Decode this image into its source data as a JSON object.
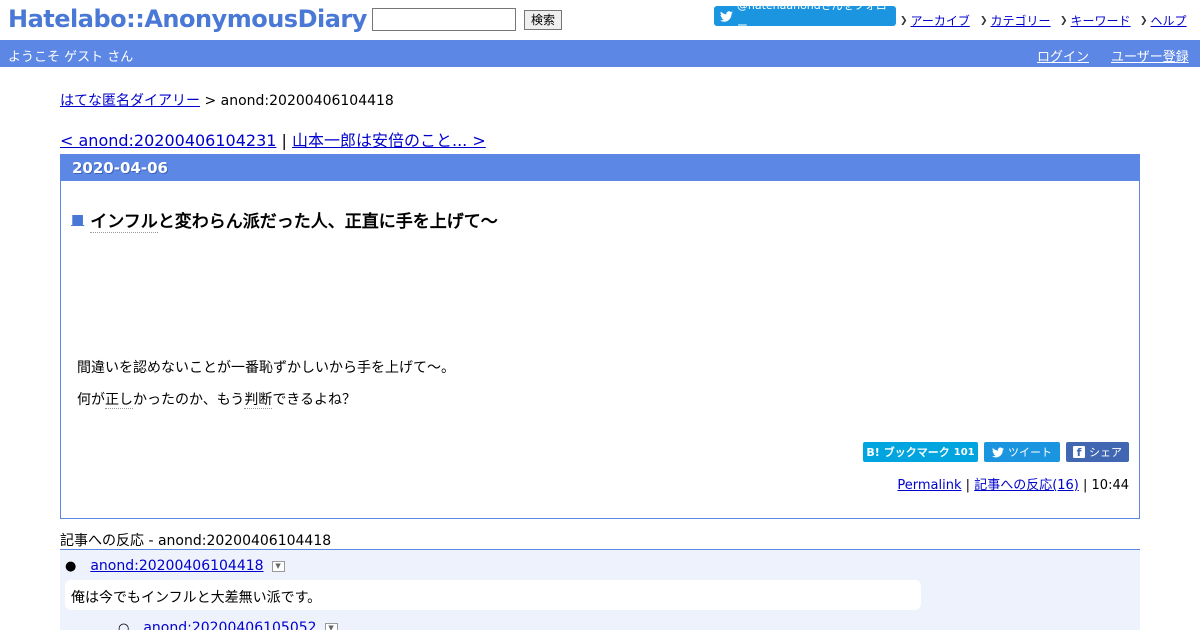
{
  "header": {
    "logo": "Hatelabo::AnonymousDiary",
    "search_button": "検索",
    "follow_button": "@hatenaanondさんをフォロー",
    "nav": [
      {
        "label": "アーカイブ"
      },
      {
        "label": "カテゴリー"
      },
      {
        "label": "キーワード"
      },
      {
        "label": "ヘルプ"
      }
    ]
  },
  "bluebar": {
    "welcome": "ようこそ ゲスト さん",
    "login": "ログイン",
    "register": "ユーザー登録"
  },
  "breadcrumb": {
    "home": "はてな匿名ダイアリー",
    "separator": " > ",
    "current": "anond:20200406104418"
  },
  "prevnext": {
    "prev": "< anond:20200406104231",
    "separator": " | ",
    "next": "山本一郎は安倍のこと... >"
  },
  "day": {
    "date": "2020-04-06",
    "entry": {
      "marker": "■",
      "title_kw": "インフル",
      "title_rest": "と変わらん派だった人、正直に手を上げて～",
      "para1": "間違いを認めないことが一番恥ずかしいから手を上げて～。",
      "para2_a": "何が",
      "para2_kw1": "正し",
      "para2_b": "かったのか、もう",
      "para2_kw2": "判断",
      "para2_c": "できるよね？",
      "bookmark_label": "ブックマーク",
      "bookmark_count": "101",
      "tweet_label": "ツイート",
      "share_label": "シェア",
      "permalink": "Permalink",
      "reactions_link": "記事への反応(16)",
      "time": "10:44"
    }
  },
  "reactions": {
    "title": "記事への反応 - anond:20200406104418",
    "items": [
      {
        "id": "anond:20200406104418",
        "body": "俺は今でもインフルと大差無い派です。"
      },
      {
        "id": "anond:20200406105052"
      }
    ]
  },
  "colors": {
    "accent": "#5c87e5",
    "twitter": "#1b95e0",
    "hatena_bookmark": "#00a4de",
    "facebook": "#4267b2"
  }
}
